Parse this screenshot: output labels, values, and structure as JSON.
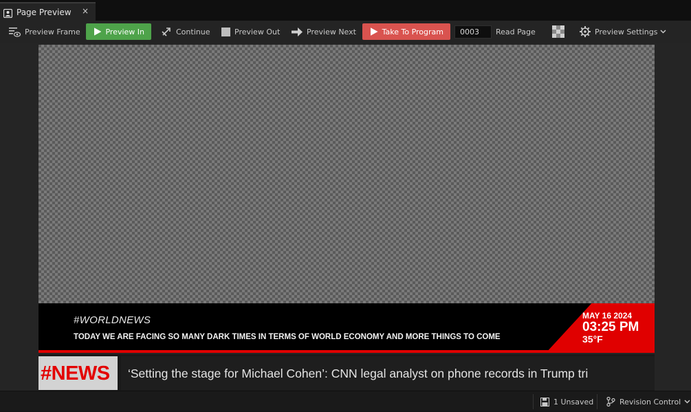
{
  "tab": {
    "label": "Page Preview",
    "close_glyph": "×",
    "icon": "page-preview-icon"
  },
  "toolbar": {
    "preview_frame": "Preview Frame",
    "preview_in": "Preview In",
    "continue": "Continue",
    "preview_out": "Preview Out",
    "preview_next": "Preview Next",
    "take_to_program": "Take To Program",
    "page_number": "0003",
    "read_page": "Read Page",
    "preview_settings": "Preview Settings",
    "colors": {
      "preview_in": "#4ea34a",
      "take_to_program": "#d9534f"
    }
  },
  "preview": {
    "lower_third": {
      "hashtag": "#WORLDNEWS",
      "headline": "TODAY WE ARE FACING SO MANY DARK TIMES IN TERMS OF WORLD ECONOMY AND MORE THINGS TO COME",
      "date": "MAY 16 2024",
      "time": "03:25 PM",
      "temperature": "35°F",
      "accent_color": "#e00000"
    },
    "news_bar": {
      "tag": "#NEWS",
      "ticker": "‘Setting the stage for Michael Cohen’: CNN legal analyst on phone records in Trump tri"
    }
  },
  "statusbar": {
    "unsaved": "1 Unsaved",
    "revision_control": "Revision Control"
  }
}
